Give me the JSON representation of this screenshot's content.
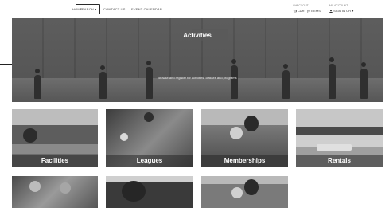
{
  "nav": {
    "items": [
      {
        "key": "home",
        "label": "HOME"
      },
      {
        "key": "search",
        "label": "SEARCH ▾"
      },
      {
        "key": "contact",
        "label": "CONTACT US"
      },
      {
        "key": "events",
        "label": "EVENT CALENDAR"
      }
    ],
    "cart": {
      "caption": "CHECKOUT",
      "value": "CART (0 ITEMS)"
    },
    "account": {
      "caption": "MY ACCOUNT",
      "value": "SIGN IN OR ▾"
    }
  },
  "hero": {
    "title": "Activities",
    "subtitle": "Browse and register for activities, classes and programs"
  },
  "cards": [
    {
      "key": "facilities",
      "label": "Facilities"
    },
    {
      "key": "leagues",
      "label": "Leagues"
    },
    {
      "key": "memberships",
      "label": "Memberships"
    },
    {
      "key": "rentals",
      "label": "Rentals"
    }
  ],
  "colors": {
    "overlay": "#3a3a3a",
    "nav_text": "#444444",
    "hero_text": "#ffffff"
  }
}
